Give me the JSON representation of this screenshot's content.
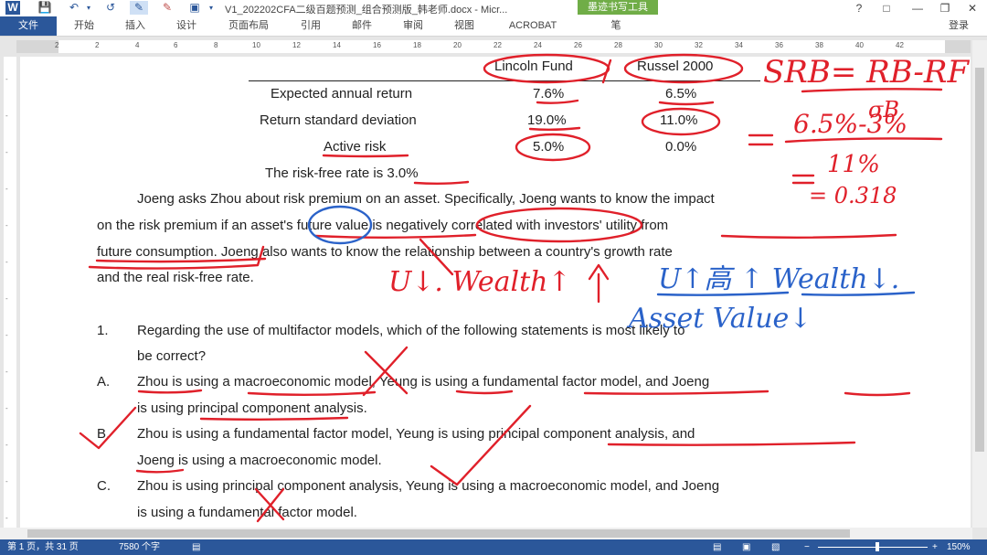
{
  "window": {
    "title": "V1_202202CFA二级百题预测_组合预测版_韩老师.docx - Micr...",
    "context_tab": "墨迹书写工具",
    "help_icon": "?"
  },
  "ribbon": {
    "tabs": [
      "文件",
      "开始",
      "插入",
      "设计",
      "页面布局",
      "引用",
      "邮件",
      "审阅",
      "视图",
      "ACROBAT",
      "笔"
    ],
    "login": "登录"
  },
  "ruler": {
    "numbers": [
      "2",
      "",
      "2",
      "4",
      "6",
      "8",
      "10",
      "12",
      "14",
      "16",
      "18",
      "20",
      "22",
      "24",
      "26",
      "28",
      "30",
      "32",
      "34",
      "36",
      "38",
      "40",
      "42"
    ]
  },
  "document": {
    "table": {
      "headers": [
        "Lincoln Fund",
        "Russel 2000"
      ],
      "rows": [
        {
          "label": "Expected annual return",
          "lincoln": "7.6%",
          "russel": "6.5%"
        },
        {
          "label": "Return standard deviation",
          "lincoln": "19.0%",
          "russel": "11.0%"
        },
        {
          "label": "Active risk",
          "lincoln": "5.0%",
          "russel": "0.0%"
        }
      ],
      "risk_free": "The risk-free rate is 3.0%"
    },
    "paragraph_lines": [
      "Joeng asks Zhou about risk premium on an asset. Specifically, Joeng wants to know the impact",
      "on the risk premium if an asset's future value is negatively correlated with investors' utility from",
      "future consumption. Joeng also wants to know the relationship between a country's growth rate",
      "and the real risk-free rate."
    ],
    "question": {
      "number": "1.",
      "lines": [
        "Regarding the use of multifactor models, which of the following statements is most likely to",
        "be correct?"
      ]
    },
    "options": [
      {
        "letter": "A.",
        "lines": [
          "Zhou is using a macroeconomic model, Yeung is using a fundamental factor model, and Joeng",
          "is using principal component analysis."
        ]
      },
      {
        "letter": "B.",
        "lines": [
          "Zhou is using a fundamental factor model, Yeung is using principal component analysis, and",
          "Joeng is using a macroeconomic model."
        ]
      },
      {
        "letter": "C.",
        "lines": [
          "Zhou is using principal component analysis, Yeung is using a macroeconomic model, and Joeng",
          "is using a fundamental factor model."
        ]
      }
    ]
  },
  "statusbar": {
    "page": "第 1 页，共 31 页",
    "words": "7580 个字",
    "zoom": "150%"
  },
  "annotations": {
    "srb": "SRB= RB-RF",
    "sigma": "σB",
    "calc_num": "6.5%-3%",
    "calc_den": "11%",
    "result": "= 0.318",
    "u_wealth": "U↓. Wealth↑",
    "u_high": "U↑高 ↑ Wealth↓.",
    "asset_value": "Asset Value↓",
    "colors": {
      "red": "#e0202a",
      "blue": "#2a62c9"
    }
  },
  "colors": {
    "accent": "#2b579a",
    "ink_tab": "#70ad47"
  }
}
